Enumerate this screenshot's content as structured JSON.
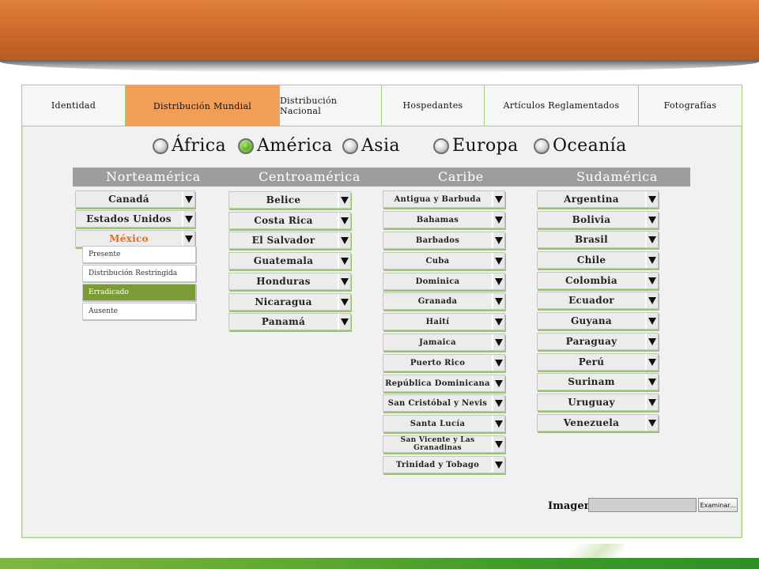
{
  "tabs": [
    {
      "label": "Identidad"
    },
    {
      "label": "Distribución Mundial",
      "active": true
    },
    {
      "label": "Distribución Nacional"
    },
    {
      "label": "Hospedantes"
    },
    {
      "label": "Artículos Reglamentados"
    },
    {
      "label": "Fotografías"
    }
  ],
  "regions": [
    {
      "label": "África",
      "selected": false
    },
    {
      "label": "América",
      "selected": true
    },
    {
      "label": "Asia",
      "selected": false
    },
    {
      "label": "Europa",
      "selected": false
    },
    {
      "label": "Oceanía",
      "selected": false
    }
  ],
  "subregions": [
    "Norteamérica",
    "Centroamérica",
    "Caribe",
    "Sudamérica"
  ],
  "norteamerica": [
    "Canadá",
    "Estados Unidos",
    "México"
  ],
  "centroamerica": [
    "Belice",
    "Costa Rica",
    "El Salvador",
    "Guatemala",
    "Honduras",
    "Nicaragua",
    "Panamá"
  ],
  "caribe": [
    "Antigua y Barbuda",
    "Bahamas",
    "Barbados",
    "Cuba",
    "Dominica",
    "Granada",
    "Haití",
    "Jamaica",
    "Puerto Rico",
    "República Dominicana",
    "San Cristóbal y Nevis",
    "Santa Lucía",
    "San Vicente y Las Granadinas",
    "Trinidad y Tobago"
  ],
  "sudamerica": [
    "Argentina",
    "Bolivia",
    "Brasil",
    "Chile",
    "Colombia",
    "Ecuador",
    "Guyana",
    "Paraguay",
    "Perú",
    "Surinam",
    "Uruguay",
    "Venezuela"
  ],
  "status_menu": {
    "options": [
      "Presente",
      "Distribución Restringida",
      "Erradicado",
      "Ausente"
    ],
    "selected": "Erradicado"
  },
  "imagen": {
    "label": "Imagen",
    "value": "",
    "browse_label": "Examinar..."
  },
  "colors": {
    "accent_orange": "#f29d58",
    "accent_green": "#7a9b35",
    "highlight_text": "#e56b1c"
  }
}
